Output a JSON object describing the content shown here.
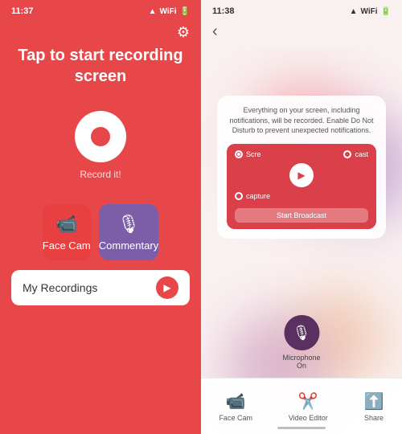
{
  "left": {
    "status_time": "11:37",
    "status_icons": "▲ ◀ ▶",
    "main_text": "Tap to start\nrecording screen",
    "record_label": "Record it!",
    "gear_icon": "⚙",
    "face_cam_label": "Face Cam",
    "commentary_label": "Commentary",
    "recordings_label": "My Recordings",
    "arrow_icon": "▶"
  },
  "right": {
    "status_time": "11:38",
    "back_icon": "‹",
    "broadcast_info": "Everything on your screen, including notifications, will be recorded. Enable Do Not Disturb to prevent unexpected notifications.",
    "screen_label": "Scre",
    "cast_label": "cast",
    "capture_label": "capture",
    "start_broadcast_label": "Start Broadcast",
    "microphone_label": "Microphone\nOn",
    "tabs": [
      {
        "label": "Face Cam",
        "icon": "📹"
      },
      {
        "label": "Video Editor",
        "icon": "✂"
      },
      {
        "label": "Share",
        "icon": "⬆"
      }
    ]
  }
}
